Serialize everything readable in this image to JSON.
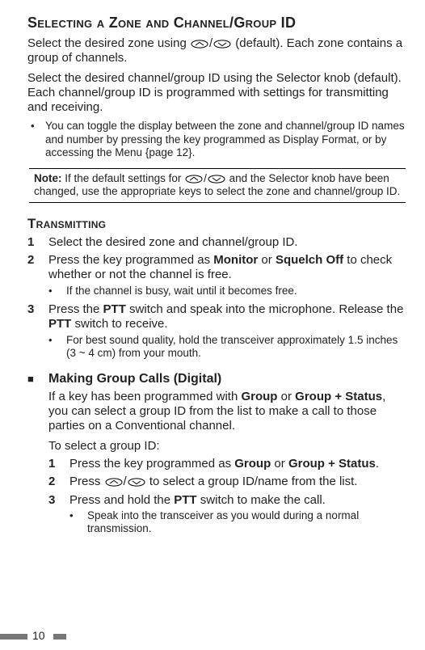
{
  "heading1": "Selecting a Zone and Channel/Group ID",
  "para1a": "Select the desired zone using ",
  "para1b": " (default).  Each zone contains a group of channels.",
  "para2": "Select the desired channel/group ID using the Selector knob (default).  Each channel/group ID is programmed with settings for transmitting and receiving.",
  "bullet1": "You can toggle the display between the zone and channel/group ID names and number by pressing the key programmed as Display Format, or by accessing the Menu {page 12}.",
  "note_label": "Note:",
  "note_a": "  If the default settings for ",
  "note_b": " and the Selector knob have been changed, use the appropriate keys to select the zone and channel/group ID.",
  "heading2": "Transmitting",
  "ol1": {
    "i1": "Select the desired zone and channel/group ID.",
    "i2a": "Press the key programmed as ",
    "i2b": "Monitor",
    "i2c": " or ",
    "i2d": "Squelch Off",
    "i2e": " to check whether or not the channel is free.",
    "i2_sub": "If the channel is busy, wait until it becomes free.",
    "i3a": "Press the ",
    "i3b": "PTT",
    "i3c": " switch and speak into the microphone. Release the ",
    "i3d": "PTT",
    "i3e": " switch to receive.",
    "i3_sub": "For best sound quality, hold the transceiver approximately 1.5 inches (3 ~ 4 cm) from your mouth."
  },
  "heading3": "Making Group Calls (Digital)",
  "group_para_a": "If a key has been programmed with ",
  "group_para_b": "Group",
  "group_para_c": " or ",
  "group_para_d": "Group + Status",
  "group_para_e": ", you can select a group ID from the list to make a call to those parties on a Conventional channel.",
  "group_para_f": "To select a group ID:",
  "ol2": {
    "i1a": "Press the key programmed as ",
    "i1b": "Group",
    "i1c": " or ",
    "i1d": "Group + Status",
    "i1e": ".",
    "i2a": "Press ",
    "i2b": " to select a group ID/name from the list.",
    "i3a": "Press and hold the ",
    "i3b": "PTT",
    "i3c": " switch to make the call.",
    "i3_sub": "Speak into the transceiver as you would during a normal transmission."
  },
  "page_number": "10",
  "icons": {
    "slash": "/"
  }
}
